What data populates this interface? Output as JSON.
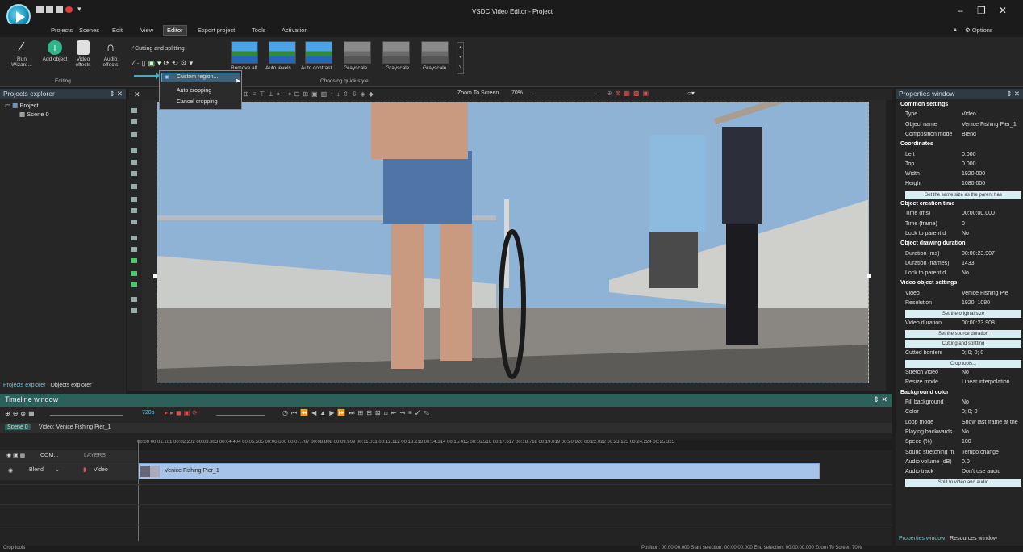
{
  "app": {
    "title": "VSDC Video Editor - Project"
  },
  "menu": [
    "Projects",
    "Scenes",
    "Edit",
    "View",
    "Editor",
    "Export project",
    "Tools",
    "Activation"
  ],
  "options_label": "Options",
  "ribbon": {
    "run_wizard": "Run Wizard...",
    "add_object": "Add object",
    "video_effects": "Video effects",
    "audio_effects": "Audio effects",
    "editing_group": "Editing",
    "cutting_splitting": "Cutting and splitting",
    "quick_style_group": "Choosing quick style",
    "styles": [
      "Remove all",
      "Auto levels",
      "Auto contrast",
      "Grayscale",
      "Grayscale",
      "Grayscale"
    ]
  },
  "crop_menu": [
    "Custom region...",
    "Auto cropping",
    "Cancel cropping"
  ],
  "projects_explorer": {
    "title": "Projects explorer",
    "items": [
      "Project",
      "Scene 0"
    ],
    "tabs": [
      "Projects explorer",
      "Objects explorer"
    ]
  },
  "toolbar": {
    "zoom_label": "Zoom To Screen",
    "zoom_value": "70%"
  },
  "properties": {
    "title": "Properties window",
    "tabs": [
      "Properties window",
      "Resources window"
    ],
    "rows": [
      {
        "k": "Common settings",
        "v": "",
        "h": true
      },
      {
        "k": "Type",
        "v": "Video"
      },
      {
        "k": "Object name",
        "v": "Venice Fishing Pier_1"
      },
      {
        "k": "Composition mode",
        "v": "Blend"
      },
      {
        "k": "Coordinates",
        "v": "",
        "h": true
      },
      {
        "k": "Left",
        "v": "0.000"
      },
      {
        "k": "Top",
        "v": "0.000"
      },
      {
        "k": "Width",
        "v": "1920.000"
      },
      {
        "k": "Height",
        "v": "1080.000"
      },
      {
        "b": "Set the same size as the parent has"
      },
      {
        "k": "Object creation time",
        "v": "",
        "h": true
      },
      {
        "k": "Time (ms)",
        "v": "00:00:00.000"
      },
      {
        "k": "Time (frame)",
        "v": "0"
      },
      {
        "k": "Lock to parent d",
        "v": "No"
      },
      {
        "k": "Object drawing duration",
        "v": "",
        "h": true
      },
      {
        "k": "Duration (ms)",
        "v": "00:00:23.907"
      },
      {
        "k": "Duration (frames)",
        "v": "1433"
      },
      {
        "k": "Lock to parent d",
        "v": "No"
      },
      {
        "k": "Video object settings",
        "v": "",
        "h": true
      },
      {
        "k": "Video",
        "v": "Venice Fishing Pie"
      },
      {
        "k": "Resolution",
        "v": "1920; 1080"
      },
      {
        "b": "Set the original size"
      },
      {
        "k": "Video duration",
        "v": "00:00:23.908"
      },
      {
        "b": "Set the source duration"
      },
      {
        "b": "Cutting and splitting"
      },
      {
        "k": "Cutted borders",
        "v": "0; 0; 0; 0"
      },
      {
        "b": "Crop tools..."
      },
      {
        "k": "Stretch video",
        "v": "No"
      },
      {
        "k": "Resize mode",
        "v": "Linear interpolation"
      },
      {
        "k": "Background color",
        "v": "",
        "h": true
      },
      {
        "k": "Fill background",
        "v": "No"
      },
      {
        "k": "Color",
        "v": "0; 0; 0"
      },
      {
        "k": "Loop mode",
        "v": "Show last frame at the"
      },
      {
        "k": "Playing backwards",
        "v": "No"
      },
      {
        "k": "Speed (%)",
        "v": "100"
      },
      {
        "k": "Sound stretching m",
        "v": "Tempo change"
      },
      {
        "k": "Audio volume (dB)",
        "v": "0.0"
      },
      {
        "k": "Audio track",
        "v": "Don't use audio"
      },
      {
        "b": "Split to video and audio"
      }
    ]
  },
  "timeline": {
    "title": "Timeline window",
    "resolution": "720p",
    "tabs": [
      "Scene 0",
      "Video: Venice Fishing Pier_1"
    ],
    "layers_label": "LAYERS",
    "com_label": "COM...",
    "blend": "Blend",
    "track": "Video",
    "clip": "Venice Fishing Pier_1",
    "ruler": "00:00  00:01.101  00:02.202  00:03.303  00:04.404  00:05.505  00:06.606  00:07.707  00:08.808  00:09.909  00:11.011  00:12.112  00:13.213  00:14.314  00:15.415  00:16.516  00:17.617  00:18.718  00:19.819  00:20.920  00:22.022  00:23.123  00:24.224  00:25.325"
  },
  "status": {
    "left": "Crop tools",
    "right": "Position:  00:00:00.000   Start selection:  00:00:00.000   End selection:  00:00:00.000   Zoom To Screen  70%"
  }
}
